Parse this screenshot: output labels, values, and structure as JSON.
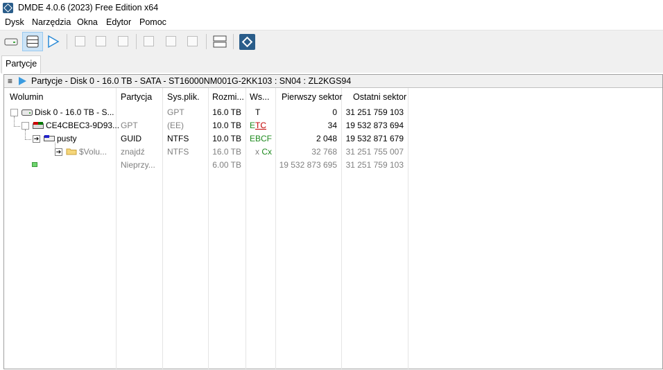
{
  "window": {
    "title": "DMDE 4.0.6 (2023) Free Edition x64"
  },
  "menu": [
    "Dysk",
    "Narzędzia",
    "Okna",
    "Edytor",
    "Pomoc"
  ],
  "tabs": [
    "Partycje"
  ],
  "panel": {
    "header": "Partycje - Disk 0 - 16.0 TB - SATA - ST16000NM001G-2KK103 : SN04 : ZL2KGS94"
  },
  "columns": [
    "Wolumin",
    "Partycja",
    "Sys.plik.",
    "Rozmi...",
    "Ws...",
    "Pierwszy sektor",
    "Ostatni sektor"
  ],
  "rows": [
    {
      "volume": "Disk 0 - 16.0 TB - S...",
      "partition": "",
      "fs": "GPT",
      "size": "16.0 TB",
      "flags_a": "T",
      "flags_b": "",
      "first": "0",
      "last": "31 251 759 103"
    },
    {
      "volume": "CE4CBEC3-9D93...",
      "partition": "GPT",
      "fs": "(EE)",
      "size": "10.0 TB",
      "flags_a": "E",
      "flags_b": "TC",
      "first": "34",
      "last": "19 532 873 694"
    },
    {
      "volume": "pusty",
      "partition": "GUID",
      "fs": "NTFS",
      "size": "10.0 TB",
      "flags_a": "EBCF",
      "flags_b": "",
      "first": "2 048",
      "last": "19 532 871 679"
    },
    {
      "volume": "$Volu...",
      "partition": "znajdź",
      "fs": "NTFS",
      "size": "16.0 TB",
      "flags_a": "x",
      "flags_b": "Cx",
      "first": "32 768",
      "last": "31 251 755 007"
    },
    {
      "volume": "",
      "partition": "Nieprzy...",
      "fs": "",
      "size": "6.00 TB",
      "flags_a": "",
      "flags_b": "",
      "first": "19 532 873 695",
      "last": "31 251 759 103"
    }
  ],
  "colors": {
    "accent": "#3a9be0",
    "active_button": "#cce4f7",
    "green_flag": "#1e8a1e",
    "red_flag": "#c00000"
  }
}
